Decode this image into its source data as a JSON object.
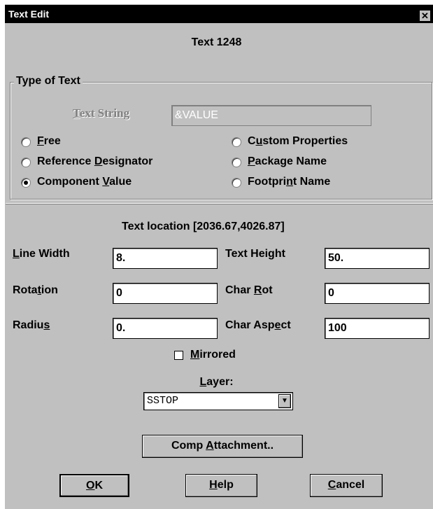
{
  "window": {
    "title": "Text Edit",
    "close_label": "✕"
  },
  "header": {
    "text_id": "Text 1248"
  },
  "type_group": {
    "legend": "Type of Text",
    "text_string_label": "Text String",
    "text_string_value": "&VALUE",
    "radios": [
      {
        "label": "Free",
        "checked": false
      },
      {
        "label": "Reference Designator",
        "checked": false
      },
      {
        "label": "Component Value",
        "checked": true
      },
      {
        "label": "Custom Properties",
        "checked": false
      },
      {
        "label": "Package Name",
        "checked": false
      },
      {
        "label": "Footprint Name",
        "checked": false
      }
    ]
  },
  "location": {
    "text": "Text location [2036.67,4026.87]"
  },
  "fields": {
    "line_width": {
      "label": "Line Width",
      "value": "8."
    },
    "text_height": {
      "label": "Text Height",
      "value": "50."
    },
    "rotation": {
      "label": "Rotation",
      "value": "0"
    },
    "char_rot": {
      "label": "Char Rot",
      "value": "0"
    },
    "radius": {
      "label": "Radius",
      "value": "0."
    },
    "char_aspect": {
      "label": "Char Aspect",
      "value": "100"
    }
  },
  "mirrored": {
    "label": "Mirrored",
    "checked": false
  },
  "layer": {
    "label": "Layer:",
    "selected": "SSTOP"
  },
  "buttons": {
    "comp_attachment": "Comp Attachment..",
    "ok": "OK",
    "help": "Help",
    "cancel": "Cancel"
  }
}
